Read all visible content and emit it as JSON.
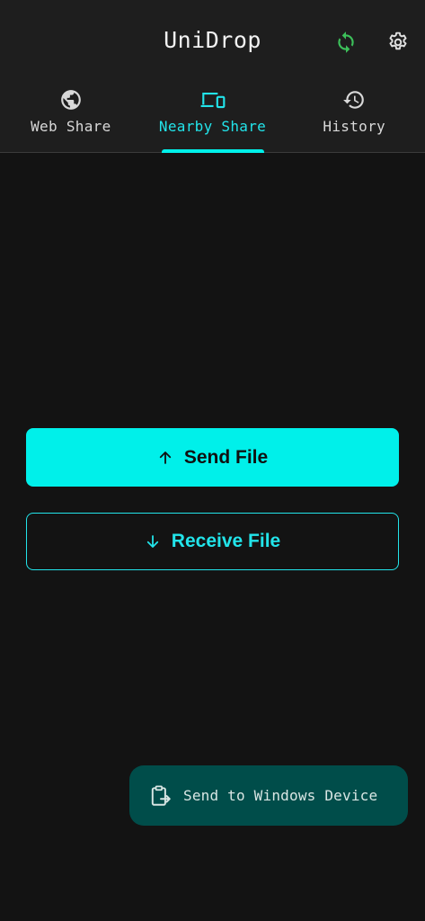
{
  "app": {
    "title": "UniDrop"
  },
  "toolbar": {
    "sync_icon": "sync-icon",
    "settings_icon": "gear-icon"
  },
  "tabs": [
    {
      "label": "Web Share",
      "icon": "globe-icon",
      "active": false
    },
    {
      "label": "Nearby Share",
      "icon": "devices-icon",
      "active": true
    },
    {
      "label": "History",
      "icon": "history-icon",
      "active": false
    }
  ],
  "actions": {
    "send_label": "Send File",
    "receive_label": "Receive File"
  },
  "fab": {
    "label": "Send to Windows Device",
    "icon": "clipboard-send-icon"
  },
  "colors": {
    "accent": "#00f0ea",
    "background": "#131313",
    "topbar": "#1e1e1e",
    "sync_green": "#3cc05a",
    "fab_bg": "#004d4a"
  }
}
